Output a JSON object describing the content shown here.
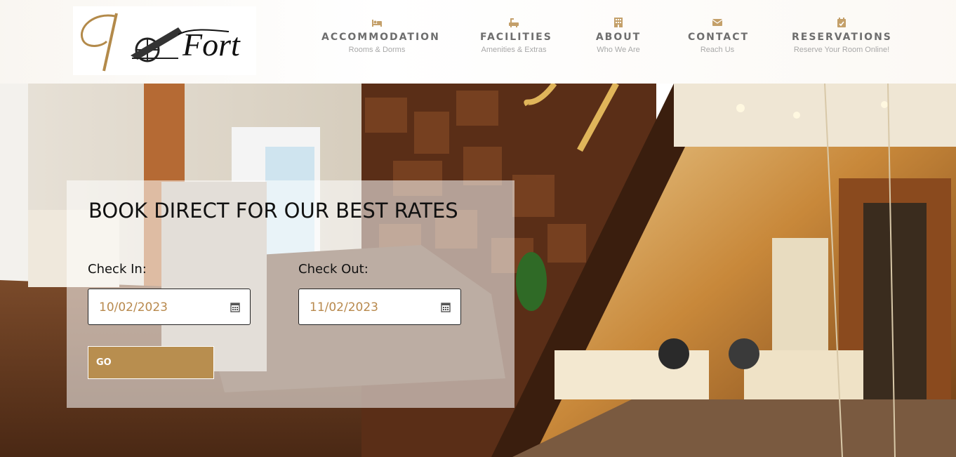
{
  "brand": {
    "name": "C1 Fort",
    "logo_icon": "cannon-logo"
  },
  "nav": [
    {
      "title": "ACCOMMODATION",
      "subtitle": "Rooms & Dorms",
      "icon": "bed-icon"
    },
    {
      "title": "FACILITIES",
      "subtitle": "Amenities & Extras",
      "icon": "bath-icon"
    },
    {
      "title": "ABOUT",
      "subtitle": "Who We Are",
      "icon": "building-icon"
    },
    {
      "title": "CONTACT",
      "subtitle": "Reach Us",
      "icon": "envelope-icon"
    },
    {
      "title": "RESERVATIONS",
      "subtitle": "Reserve Your Room Online!",
      "icon": "calendar-check-icon"
    }
  ],
  "booking": {
    "title": "BOOK DIRECT FOR OUR BEST RATES",
    "check_in_label": "Check In:",
    "check_in_value": "10/02/2023",
    "check_out_label": "Check Out:",
    "check_out_value": "11/02/2023",
    "go_label": "GO"
  },
  "colors": {
    "accent": "#b88e4f",
    "nav_text": "#6e6e6e",
    "nav_subtext": "#a8a8a8",
    "date_text": "#b8894d"
  }
}
